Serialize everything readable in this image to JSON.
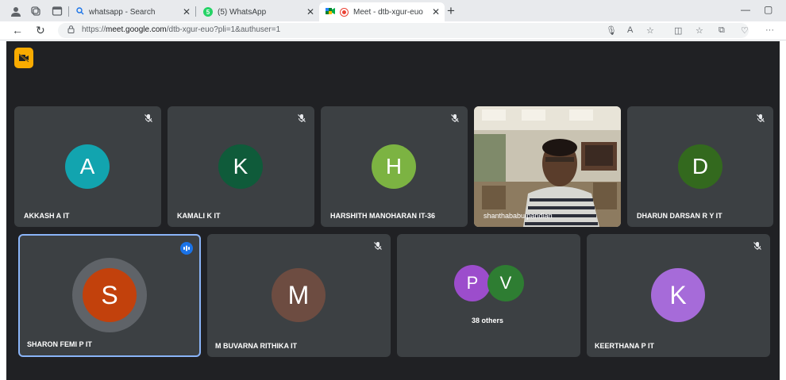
{
  "browser": {
    "tabs": [
      {
        "label": "whatsapp - Search",
        "favicon": "search-icon"
      },
      {
        "label": "(5) WhatsApp",
        "favicon": "whatsapp-icon",
        "favicon_text": "5"
      },
      {
        "label": "Meet - dtb-xgur-euo",
        "favicon": "meet-icon",
        "active": true
      }
    ],
    "url_prefix": "https://",
    "url_host": "meet.google.com",
    "url_path": "/dtb-xgur-euo?pli=1&authuser=1"
  },
  "meet": {
    "row1": [
      {
        "name": "AKKASH A IT",
        "initial": "A",
        "color": "#12a4af",
        "muted": true
      },
      {
        "name": "KAMALI K IT",
        "initial": "K",
        "color": "#0f5b3a",
        "muted": true
      },
      {
        "name": "HARSHITH MANOHARAN IT-36",
        "initial": "H",
        "color": "#7cb342",
        "muted": true
      },
      {
        "name": "shanthababu pandian",
        "video": true,
        "muted": false
      },
      {
        "name": "DHARUN DARSAN R Y IT",
        "initial": "D",
        "color": "#33691e",
        "muted": true
      }
    ],
    "row2": [
      {
        "name": "SHARON FEMI P IT",
        "initial": "S",
        "color": "#c2410c",
        "speaking": true
      },
      {
        "name": "M BUVARNA RITHIKA IT",
        "initial": "M",
        "color": "#6d4c41",
        "muted": true
      },
      {
        "others_label": "38 others",
        "avatars": [
          {
            "initial": "P",
            "color": "#9c4dcc"
          },
          {
            "initial": "V",
            "color": "#2e7d32"
          }
        ]
      },
      {
        "name": "KEERTHANA P IT",
        "initial": "K",
        "color": "#a66bd9",
        "muted": true
      }
    ]
  },
  "colors": {
    "stage": "#202124",
    "tile": "#3c4043",
    "accent": "#8ab4f8",
    "cam_off_badge": "#f9ab00"
  }
}
